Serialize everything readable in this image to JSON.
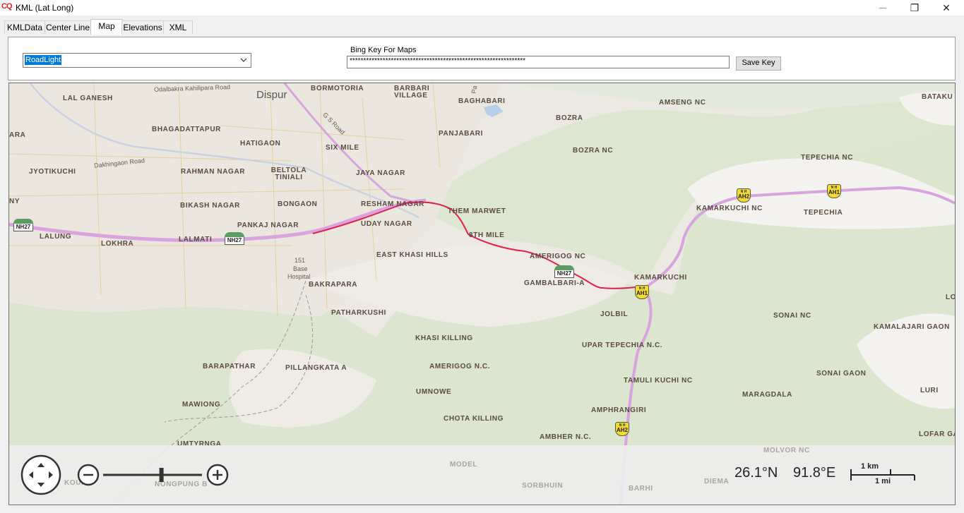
{
  "window": {
    "icon_text": "CQ",
    "title": "KML (Lat Long)",
    "minimize": "—",
    "restore": "❐",
    "close": "✕"
  },
  "tabs": [
    {
      "label": "KMLData"
    },
    {
      "label": "Center Line"
    },
    {
      "label": "Map",
      "active": true
    },
    {
      "label": "Elevations"
    },
    {
      "label": "XML"
    }
  ],
  "toolbar": {
    "map_style_value": "RoadLight",
    "bing_key_label": "Bing Key For Maps",
    "bing_key_value": "****************************************************************",
    "save_key_label": "Save Key"
  },
  "map": {
    "city_label": "Dispur",
    "places": [
      "LAL GANESH",
      "BHAGADATTAPUR",
      "HATIGAON",
      "SIX MILE",
      "JYOTIKUCHI",
      "RAHMAN NAGAR",
      "BELTOLA TINIALI",
      "JAYA NAGAR",
      "BIKASH NAGAR",
      "BONGAON",
      "RESHAM NAGAR",
      "THEM MARWET",
      "PANKAJ NAGAR",
      "UDAY NAGAR",
      "8TH MILE",
      "LALUNG",
      "LALMATI",
      "LOKHRA",
      "EAST KHASI HILLS",
      "AMERIGOG NC",
      "BAKRAPARA",
      "GAMBALBARI-A",
      "KAMARKUCHI",
      "PATHARKUSHI",
      "JOLBIL",
      "KHASI KILLING",
      "UPAR TEPECHIA N.C.",
      "BARAPATHAR",
      "PILLANGKATA A",
      "AMERIGOG N.C.",
      "UMNOWE",
      "TAMULI KUCHI NC",
      "MAWIONG",
      "AMPHRANGIRI",
      "CHOTA KILLING",
      "UMTYRNGA",
      "AMBHER N.C.",
      "BORMOTORIA",
      "BARBARI VILLAGE",
      "BAGHABARI",
      "PANJABARI",
      "BOZRA",
      "BOZRA NC",
      "AMSENG NC",
      "TEPECHIA NC",
      "KAMARKUCHI NC",
      "TEPECHIA",
      "SONAI NC",
      "KAMALAJARI GAON",
      "SONAI GAON",
      "MARAGDALA",
      "LURI",
      "LOFAR GA",
      "BATAKU",
      "ARA",
      "NY",
      "LO"
    ],
    "roads": [
      "Odalbakra Kahilipara Road",
      "Dakhingaon Road",
      "G S Road",
      "Pa"
    ],
    "hospital": [
      "151",
      "Base",
      "Hospital"
    ],
    "shields": [
      "NH27",
      "NH27",
      "NH27",
      "AH2",
      "AH1",
      "AH1",
      "AH2"
    ],
    "shield_prefix": "N H",
    "faded": [
      "MOLVOR NC",
      "MODEL",
      "NONGPUNG B",
      "SORBHUIN",
      "BARHI",
      "DIEMA",
      "KOURH"
    ],
    "colors": {
      "route": "#e0204a",
      "highway": "#d9a3e0",
      "forest": "#dde6cf",
      "urban": "#ece9e2"
    }
  },
  "nav": {
    "zoom_level": 0.59,
    "lat": "26.1°N",
    "lon": "91.8°E",
    "scale_km": "1 km",
    "scale_mi": "1 mi"
  }
}
